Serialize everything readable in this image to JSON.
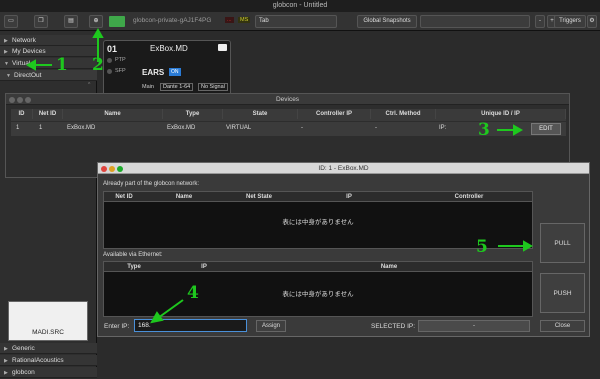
{
  "app": {
    "title": "globcon - Untitled"
  },
  "toolbar": {
    "device_name": "globcon-private-gAJ1F4PG",
    "badge_left": "...",
    "badge_right": "MS",
    "tab_select": "Tab",
    "snapshots_label": "Global Snapshots",
    "minus": "-",
    "plus": "+",
    "triggers": "Triggers"
  },
  "sidebar": {
    "network": "Network",
    "my_devices": "My Devices",
    "virtual": "Virtual",
    "directout": "DirectOut",
    "madi_src": "MADI.SRC",
    "generic": "Generic",
    "rational": "RationalAcoustics",
    "globcon": "globcon"
  },
  "card": {
    "number": "01",
    "name": "ExBox.MD",
    "ptp": "PTP",
    "sfp": "SFP",
    "ears": "EARS",
    "on": "ON",
    "main": "Main",
    "dante": "Dante 1-64",
    "signal": "No Signal"
  },
  "devices": {
    "title": "Devices",
    "columns": [
      "ID",
      "Net ID",
      "Name",
      "Type",
      "State",
      "Controller IP",
      "Ctrl. Method",
      "Unique ID / IP"
    ],
    "row": {
      "id": "1",
      "net_id": "1",
      "name": "ExBox.MD",
      "type": "ExBox.MD",
      "state": "VIRTUAL",
      "controller_ip": "-",
      "ctrl_method": "-",
      "unique_ip": "IP:"
    },
    "edit": "EDIT"
  },
  "dialog": {
    "title": "ID: 1 - ExBox.MD",
    "section1": "Already part of the globcon network:",
    "cols1": [
      "Net ID",
      "Name",
      "Net State",
      "IP",
      "Controller"
    ],
    "empty1": "表には中身がありません",
    "section2": "Available via Ethernet:",
    "cols2": [
      "Type",
      "IP",
      "Name"
    ],
    "empty2": "表には中身がありません",
    "pull": "PULL",
    "push": "PUSH",
    "enter_ip_label": "Enter IP:",
    "enter_ip_value": "168.",
    "assign": "Assign",
    "selected_ip_label": "SELECTED IP:",
    "selected_ip_value": "-",
    "close": "Close"
  },
  "annotations": {
    "a1": "1",
    "a2": "2",
    "a3": "3",
    "a4": "4",
    "a5": "5"
  },
  "colors": {
    "annotation": "#1ec81e",
    "accent_green": "#3fa84a",
    "on_badge": "#2a7bd6"
  }
}
